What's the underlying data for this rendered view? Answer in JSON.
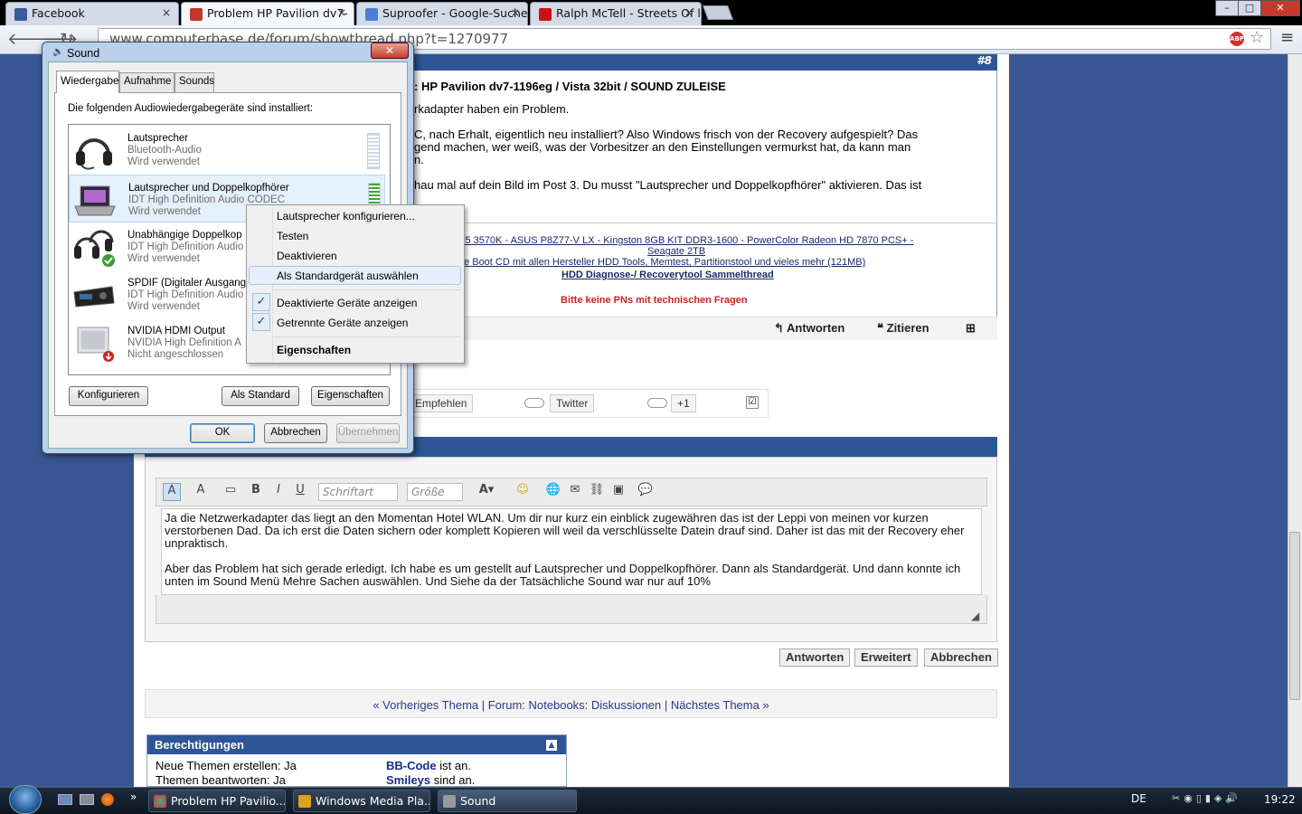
{
  "browser": {
    "tabs": [
      {
        "label": "Facebook",
        "color": "#3b5998"
      },
      {
        "label": "Problem HP Pavilion dv7-",
        "color": "#c0392b"
      },
      {
        "label": "Suproofer - Google-Suche",
        "color": "#4a7fd6"
      },
      {
        "label": "Ralph McTell - Streets Of l",
        "color": "#cc1111"
      }
    ],
    "url": "www.computerbase.de/forum/showthread.php?t=1270977",
    "close_glyph": "×"
  },
  "post": {
    "number": "#8",
    "title": "Re: HP Pavilion dv7-1196eg / Vista 32bit / SOUND ZULEISE",
    "title_visible": ": HP Pavilion dv7-1196eg / Vista 32bit / SOUND ZULEISE",
    "lines": [
      "rkadapter haben ein Problem.",
      "C, nach Erhalt, eigentlich neu installiert? Also Windows frisch von der Recovery aufgespielt? Das",
      "gend machen, wer weiß, was der Vorbesitzer an den Einstellungen vermurkst hat, da kann man",
      "n.",
      "hau mal auf dein Bild im Post 3. Du musst \"Lautsprecher und Doppelkopfhörer\" aktivieren. Das ist"
    ],
    "signature": [
      "i5 3570K - ASUS P8Z77-V LX - Kingston 8GB KIT DDR3-1600 - PowerColor Radeon HD 7870 PCS+ -",
      "Seagate 2TB",
      "te Boot CD mit allen Hersteller HDD Tools, Memtest, Partitionstool und vieles mehr (121MB)",
      "HDD Diagnose-/ Recoverytool Sammelthread",
      "Bitte keine PNs mit technischen Fragen"
    ],
    "actions": {
      "reply": "Antworten",
      "quote": "Zitieren"
    }
  },
  "share": {
    "recommend": "Empfehlen",
    "twitter": "Twitter",
    "plusone": "+1"
  },
  "editor": {
    "font_placeholder": "Schriftart",
    "size_placeholder": "Größe",
    "text1": "Ja die Netzwerkadapter das liegt an den Momentan Hotel WLAN. Um dir nur kurz ein einblick zugewähren das ist der Leppi von meinen vor kurzen verstorbenen Dad. Da ich erst die Daten sichern oder komplett Kopieren will weil da verschlüsselte Datein drauf sind. Daher ist das mit der Recovery eher unpraktisch.",
    "text2": "Aber das Problem hat sich gerade erledigt. Ich habe es um gestellt auf Lautsprecher und Doppelkopfhörer. Dann als Standardgerät. Und dann konnte ich unten im Sound Menü Mehre Sachen auswählen. Und Siehe da der Tatsächliche Sound war nur auf 10%",
    "reply_btn": "Antworten",
    "advanced_btn": "Erweitert",
    "cancel_btn": "Abbrechen"
  },
  "thread_nav": "« Vorheriges Thema | Forum: Notebooks: Diskussionen | Nächstes Thema »",
  "permissions": {
    "title": "Berechtigungen",
    "rows": [
      "Neue Themen erstellen: Ja",
      "Themen beantworten: Ja"
    ],
    "bbcode": "BB-Code",
    "bbcode_suffix": "ist an.",
    "smileys": "Smileys",
    "smileys_suffix": "sind an."
  },
  "dialog": {
    "title": "Sound",
    "tabs": [
      "Wiedergabe",
      "Aufnahme",
      "Sounds"
    ],
    "intro": "Die folgenden Audiowiedergabegeräte sind installiert:",
    "devices": [
      {
        "name": "Lautsprecher",
        "driver": "Bluetooth-Audio",
        "status": "Wird verwendet"
      },
      {
        "name": "Lautsprecher und Doppelkopfhörer",
        "driver": "IDT High Definition Audio CODEC",
        "status": "Wird verwendet"
      },
      {
        "name": "Unabhängige Doppelkop",
        "driver": "IDT High Definition Audio",
        "status": "Wird verwendet"
      },
      {
        "name": "SPDIF (Digitaler Ausgang",
        "driver": "IDT High Definition Audio",
        "status": "Wird verwendet"
      },
      {
        "name": "NVIDIA HDMI Output",
        "driver": "NVIDIA High Definition A",
        "status": "Nicht angeschlossen"
      }
    ],
    "configure_btn": "Konfigurieren",
    "default_btn": "Als Standard",
    "properties_btn": "Eigenschaften",
    "ok_btn": "OK",
    "cancel_btn": "Abbrechen",
    "apply_btn": "Übernehmen"
  },
  "context_menu": {
    "items": [
      "Lautsprecher konfigurieren...",
      "Testen",
      "Deaktivieren",
      "Als Standardgerät auswählen"
    ],
    "checks": [
      "Deaktivierte Geräte anzeigen",
      "Getrennte Geräte anzeigen"
    ],
    "properties": "Eigenschaften",
    "check_glyph": "✓"
  },
  "taskbar": {
    "items": [
      "Problem HP Pavilio...",
      "Windows Media Pla...",
      "Sound"
    ],
    "lang": "DE",
    "time": "19:22"
  }
}
